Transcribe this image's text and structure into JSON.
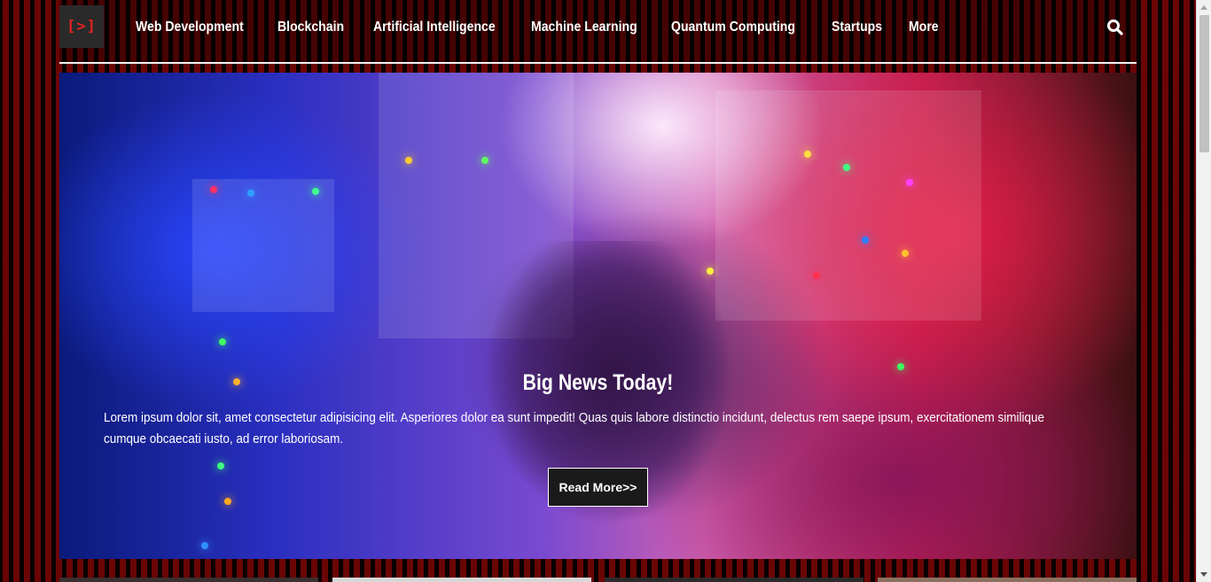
{
  "logo": {
    "text": "[>]"
  },
  "nav": {
    "items": [
      "Web Development",
      "Blockchain",
      "Artificial Intelligence",
      "Machine Learning",
      "Quantum Computing",
      "Startups",
      "More"
    ],
    "search_icon": "search-icon"
  },
  "hero": {
    "title": "Big News Today!",
    "text": "Lorem ipsum dolor sit, amet consectetur adipisicing elit. Asperiores dolor ea sunt impedit! Quas quis labore distinctio incidunt, delectus rem saepe ipsum, exercitationem similique cumque obcaecati iusto, ad error laboriosam.",
    "button_label": "Read More>>"
  },
  "colors": {
    "accent": "#e0231f",
    "background": "#0a0000",
    "stripe": "#6a0505"
  }
}
